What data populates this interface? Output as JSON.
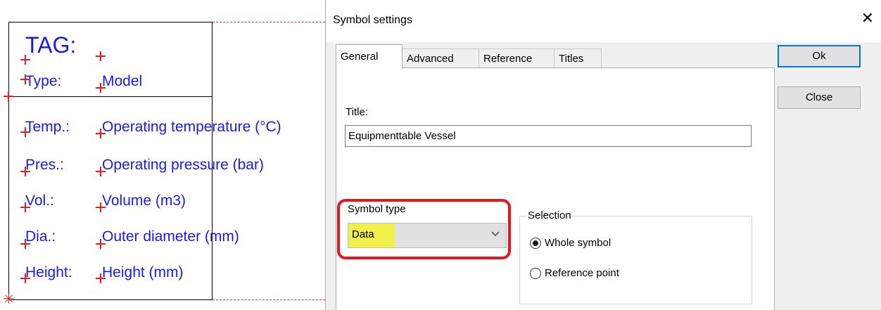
{
  "symbol": {
    "tag": "TAG:",
    "rows": [
      {
        "label": "Type:",
        "value": "Model"
      },
      {
        "label": "Temp.:",
        "value": "Operating temperature (°C)"
      },
      {
        "label": "Pres.:",
        "value": "Operating pressure (bar)"
      },
      {
        "label": "Vol.:",
        "value": "Volume (m3)"
      },
      {
        "label": "Dia.:",
        "value": "Outer diameter (mm)"
      },
      {
        "label": "Height:",
        "value": "Height (mm)"
      }
    ]
  },
  "dialog": {
    "title": "Symbol settings",
    "tabs": [
      "General",
      "Advanced",
      "Reference",
      "Titles"
    ],
    "active_tab": "General",
    "title_label": "Title:",
    "title_value": "Equipmenttable Vessel",
    "symbol_type_label": "Symbol type",
    "symbol_type_value": "Data",
    "selection_label": "Selection",
    "selection_options": [
      "Whole symbol",
      "Reference point"
    ],
    "selection_selected": "Whole symbol",
    "ok_label": "Ok",
    "close_label": "Close"
  },
  "colors": {
    "cad_text": "#1a1ae6",
    "markers": "#e02020",
    "highlight_frame": "#e8151b",
    "text_highlight": "#f2ee4a",
    "default_button_border": "#0078d7"
  }
}
